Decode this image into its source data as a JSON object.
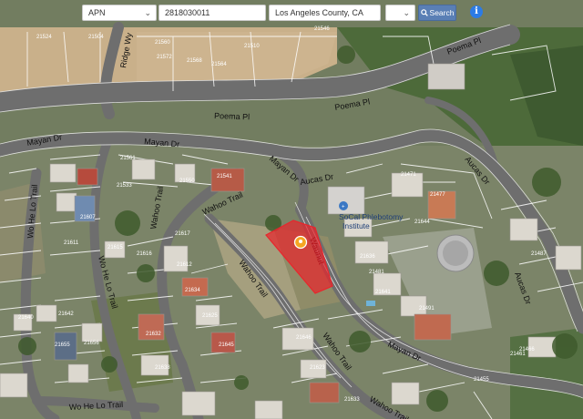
{
  "search": {
    "field_type": "APN",
    "apn_value": "2818030011",
    "county_value": "Los Angeles County, CA",
    "extra_select": "",
    "search_label": "Search",
    "icons": {
      "search": "search-icon",
      "info": "info-icon",
      "marker": "location-marker-icon"
    }
  },
  "streets": {
    "poema_pl": "Poema Pl",
    "mayan_dr": "Mayan Dr",
    "ridge_wy": "Ridge Wy",
    "wahoo_trail": "Wahoo Trail",
    "wo_he_lo_trail": "Wo He Lo Trail",
    "aucas_dr": "Aucas Dr",
    "maya_dr": "Mayan Dr",
    "waunut": "Waunut"
  },
  "poi": {
    "name_line1": "SoCal Phlebotomy",
    "name_line2": "Institute"
  },
  "parcels": [
    "21524",
    "21504",
    "21510",
    "21546",
    "21572",
    "21568",
    "21564",
    "21560",
    "21541",
    "21533",
    "21550",
    "21561",
    "21607",
    "21611",
    "21615",
    "21617",
    "21616",
    "21612",
    "21634",
    "21625",
    "21632",
    "21645",
    "21642",
    "21656",
    "21640",
    "21638",
    "21646",
    "21623",
    "21633",
    "21636",
    "21641",
    "21644",
    "21477",
    "21455",
    "21461",
    "21471",
    "21481",
    "21491",
    "21466",
    "21487",
    "21655"
  ],
  "colors": {
    "parcel_highlight": "#e8262c",
    "road": "#6f6f6f",
    "search_button": "#5a7fb5",
    "info": "#2c7be5"
  }
}
